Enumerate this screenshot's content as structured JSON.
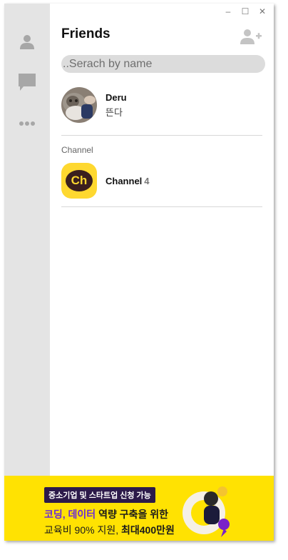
{
  "window_controls": {
    "minimize": "–",
    "maximize": "☐",
    "close": "✕"
  },
  "header": {
    "title": "Friends"
  },
  "search": {
    "placeholder": "..Serach by name"
  },
  "friends": [
    {
      "name": "Deru",
      "status": "뜬다"
    }
  ],
  "channel_section": {
    "label": "Channel",
    "item_name": "Channel",
    "count": "4",
    "logo_text": "Ch"
  },
  "ad": {
    "badge": "중소기업 및 스타트업 신청 가능",
    "line1_highlight": "코딩, 데이터",
    "line1_rest": " 역량 구축을 위한",
    "line2_plain": "교육비 90% 지원, ",
    "line2_bold": "최대400만원"
  },
  "colors": {
    "sidebar_bg": "#e4e4e4",
    "ad_bg": "#ffe202",
    "channel_yellow": "#fed830",
    "channel_brown": "#3b1f1e",
    "ad_purple": "#6a2bd9"
  },
  "icons": [
    "person-icon",
    "chat-bubble-icon",
    "more-dots-icon",
    "add-friend-icon"
  ]
}
